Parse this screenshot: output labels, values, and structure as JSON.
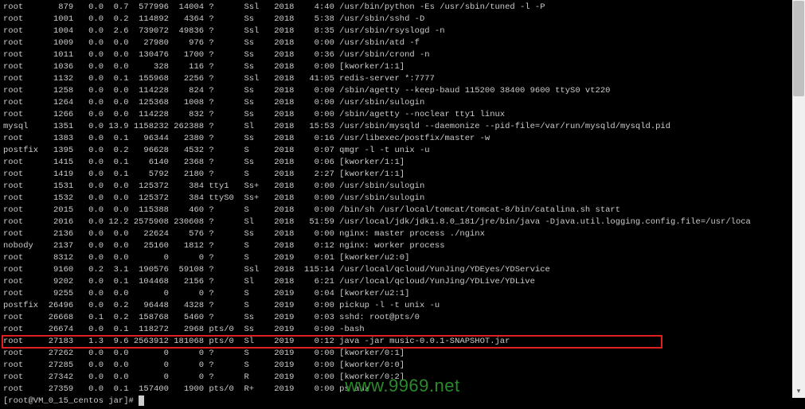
{
  "watermark": "www.9969.net",
  "prompt": "[root@VM_0_15_centos jar]# ",
  "highlight_row_index": 26,
  "rows": [
    {
      "user": "root",
      "pid": "879",
      "cpu": "0.0",
      "mem": "0.7",
      "vsz": "577996",
      "rss": "14004",
      "tty": "?",
      "stat": "Ssl",
      "start": "2018",
      "time": "4:40",
      "cmd": "/usr/bin/python -Es /usr/sbin/tuned -l -P"
    },
    {
      "user": "root",
      "pid": "1001",
      "cpu": "0.0",
      "mem": "0.2",
      "vsz": "114892",
      "rss": "4364",
      "tty": "?",
      "stat": "Ss",
      "start": "2018",
      "time": "5:38",
      "cmd": "/usr/sbin/sshd -D"
    },
    {
      "user": "root",
      "pid": "1004",
      "cpu": "0.0",
      "mem": "2.6",
      "vsz": "739072",
      "rss": "49836",
      "tty": "?",
      "stat": "Ssl",
      "start": "2018",
      "time": "8:35",
      "cmd": "/usr/sbin/rsyslogd -n"
    },
    {
      "user": "root",
      "pid": "1009",
      "cpu": "0.0",
      "mem": "0.0",
      "vsz": "27980",
      "rss": "976",
      "tty": "?",
      "stat": "Ss",
      "start": "2018",
      "time": "0:00",
      "cmd": "/usr/sbin/atd -f"
    },
    {
      "user": "root",
      "pid": "1011",
      "cpu": "0.0",
      "mem": "0.0",
      "vsz": "130476",
      "rss": "1700",
      "tty": "?",
      "stat": "Ss",
      "start": "2018",
      "time": "0:36",
      "cmd": "/usr/sbin/crond -n"
    },
    {
      "user": "root",
      "pid": "1036",
      "cpu": "0.0",
      "mem": "0.0",
      "vsz": "328",
      "rss": "116",
      "tty": "?",
      "stat": "Ss",
      "start": "2018",
      "time": "0:00",
      "cmd": "[kworker/1:1]"
    },
    {
      "user": "root",
      "pid": "1132",
      "cpu": "0.0",
      "mem": "0.1",
      "vsz": "155968",
      "rss": "2256",
      "tty": "?",
      "stat": "Ssl",
      "start": "2018",
      "time": "41:05",
      "cmd": "redis-server *:7777"
    },
    {
      "user": "root",
      "pid": "1258",
      "cpu": "0.0",
      "mem": "0.0",
      "vsz": "114228",
      "rss": "824",
      "tty": "?",
      "stat": "Ss",
      "start": "2018",
      "time": "0:00",
      "cmd": "/sbin/agetty --keep-baud 115200 38400 9600 ttyS0 vt220"
    },
    {
      "user": "root",
      "pid": "1264",
      "cpu": "0.0",
      "mem": "0.0",
      "vsz": "125368",
      "rss": "1008",
      "tty": "?",
      "stat": "Ss",
      "start": "2018",
      "time": "0:00",
      "cmd": "/usr/sbin/sulogin"
    },
    {
      "user": "root",
      "pid": "1266",
      "cpu": "0.0",
      "mem": "0.0",
      "vsz": "114228",
      "rss": "832",
      "tty": "?",
      "stat": "Ss",
      "start": "2018",
      "time": "0:00",
      "cmd": "/sbin/agetty --noclear tty1 linux"
    },
    {
      "user": "mysql",
      "pid": "1351",
      "cpu": "0.0",
      "mem": "13.9",
      "vsz": "1158232",
      "rss": "262388",
      "tty": "?",
      "stat": "Sl",
      "start": "2018",
      "time": "15:53",
      "cmd": "/usr/sbin/mysqld --daemonize --pid-file=/var/run/mysqld/mysqld.pid"
    },
    {
      "user": "root",
      "pid": "1383",
      "cpu": "0.0",
      "mem": "0.1",
      "vsz": "96344",
      "rss": "2380",
      "tty": "?",
      "stat": "Ss",
      "start": "2018",
      "time": "0:16",
      "cmd": "/usr/libexec/postfix/master -w"
    },
    {
      "user": "postfix",
      "pid": "1395",
      "cpu": "0.0",
      "mem": "0.2",
      "vsz": "96628",
      "rss": "4532",
      "tty": "?",
      "stat": "S",
      "start": "2018",
      "time": "0:07",
      "cmd": "qmgr -l -t unix -u"
    },
    {
      "user": "root",
      "pid": "1415",
      "cpu": "0.0",
      "mem": "0.1",
      "vsz": "6140",
      "rss": "2368",
      "tty": "?",
      "stat": "Ss",
      "start": "2018",
      "time": "0:06",
      "cmd": "[kworker/1:1]"
    },
    {
      "user": "root",
      "pid": "1419",
      "cpu": "0.0",
      "mem": "0.1",
      "vsz": "5792",
      "rss": "2180",
      "tty": "?",
      "stat": "S",
      "start": "2018",
      "time": "2:27",
      "cmd": "[kworker/1:1]"
    },
    {
      "user": "root",
      "pid": "1531",
      "cpu": "0.0",
      "mem": "0.0",
      "vsz": "125372",
      "rss": "384",
      "tty": "tty1",
      "stat": "Ss+",
      "start": "2018",
      "time": "0:00",
      "cmd": "/usr/sbin/sulogin"
    },
    {
      "user": "root",
      "pid": "1532",
      "cpu": "0.0",
      "mem": "0.0",
      "vsz": "125372",
      "rss": "384",
      "tty": "ttyS0",
      "stat": "Ss+",
      "start": "2018",
      "time": "0:00",
      "cmd": "/usr/sbin/sulogin"
    },
    {
      "user": "root",
      "pid": "2015",
      "cpu": "0.0",
      "mem": "0.0",
      "vsz": "115388",
      "rss": "460",
      "tty": "?",
      "stat": "S",
      "start": "2018",
      "time": "0:00",
      "cmd": "/bin/sh /usr/local/tomcat/tomcat-8/bin/catalina.sh start"
    },
    {
      "user": "root",
      "pid": "2016",
      "cpu": "0.0",
      "mem": "12.2",
      "vsz": "2575908",
      "rss": "230608",
      "tty": "?",
      "stat": "Sl",
      "start": "2018",
      "time": "51:59",
      "cmd": "/usr/local/jdk/jdk1.8.0_181/jre/bin/java -Djava.util.logging.config.file=/usr/loca"
    },
    {
      "user": "root",
      "pid": "2136",
      "cpu": "0.0",
      "mem": "0.0",
      "vsz": "22624",
      "rss": "576",
      "tty": "?",
      "stat": "Ss",
      "start": "2018",
      "time": "0:00",
      "cmd": "nginx: master process ./nginx"
    },
    {
      "user": "nobody",
      "pid": "2137",
      "cpu": "0.0",
      "mem": "0.0",
      "vsz": "25160",
      "rss": "1812",
      "tty": "?",
      "stat": "S",
      "start": "2018",
      "time": "0:12",
      "cmd": "nginx: worker process"
    },
    {
      "user": "root",
      "pid": "8312",
      "cpu": "0.0",
      "mem": "0.0",
      "vsz": "0",
      "rss": "0",
      "tty": "?",
      "stat": "S",
      "start": "2019",
      "time": "0:01",
      "cmd": "[kworker/u2:0]"
    },
    {
      "user": "root",
      "pid": "9160",
      "cpu": "0.2",
      "mem": "3.1",
      "vsz": "190576",
      "rss": "59108",
      "tty": "?",
      "stat": "Ssl",
      "start": "2018",
      "time": "115:14",
      "cmd": "/usr/local/qcloud/YunJing/YDEyes/YDService"
    },
    {
      "user": "root",
      "pid": "9202",
      "cpu": "0.0",
      "mem": "0.1",
      "vsz": "104468",
      "rss": "2156",
      "tty": "?",
      "stat": "Sl",
      "start": "2018",
      "time": "6:21",
      "cmd": "/usr/local/qcloud/YunJing/YDLive/YDLive"
    },
    {
      "user": "root",
      "pid": "9255",
      "cpu": "0.0",
      "mem": "0.0",
      "vsz": "0",
      "rss": "0",
      "tty": "?",
      "stat": "S",
      "start": "2019",
      "time": "0:04",
      "cmd": "[kworker/u2:1]"
    },
    {
      "user": "postfix",
      "pid": "26496",
      "cpu": "0.0",
      "mem": "0.2",
      "vsz": "96448",
      "rss": "4328",
      "tty": "?",
      "stat": "S",
      "start": "2019",
      "time": "0:00",
      "cmd": "pickup -l -t unix -u"
    },
    {
      "user": "root",
      "pid": "26668",
      "cpu": "0.1",
      "mem": "0.2",
      "vsz": "158768",
      "rss": "5460",
      "tty": "?",
      "stat": "Ss",
      "start": "2019",
      "time": "0:03",
      "cmd": "sshd: root@pts/0"
    },
    {
      "user": "root",
      "pid": "26674",
      "cpu": "0.0",
      "mem": "0.1",
      "vsz": "118272",
      "rss": "2968",
      "tty": "pts/0",
      "stat": "Ss",
      "start": "2019",
      "time": "0:00",
      "cmd": "-bash"
    },
    {
      "user": "root",
      "pid": "27183",
      "cpu": "1.3",
      "mem": "9.6",
      "vsz": "2563912",
      "rss": "181068",
      "tty": "pts/0",
      "stat": "Sl",
      "start": "2019",
      "time": "0:12",
      "cmd": "java -jar music-0.0.1-SNAPSHOT.jar"
    },
    {
      "user": "root",
      "pid": "27262",
      "cpu": "0.0",
      "mem": "0.0",
      "vsz": "0",
      "rss": "0",
      "tty": "?",
      "stat": "S",
      "start": "2019",
      "time": "0:00",
      "cmd": "[kworker/0:1]"
    },
    {
      "user": "root",
      "pid": "27285",
      "cpu": "0.0",
      "mem": "0.0",
      "vsz": "0",
      "rss": "0",
      "tty": "?",
      "stat": "S",
      "start": "2019",
      "time": "0:00",
      "cmd": "[kworker/0:0]"
    },
    {
      "user": "root",
      "pid": "27342",
      "cpu": "0.0",
      "mem": "0.0",
      "vsz": "0",
      "rss": "0",
      "tty": "?",
      "stat": "R",
      "start": "2019",
      "time": "0:00",
      "cmd": "[kworker/0:2]"
    },
    {
      "user": "root",
      "pid": "27359",
      "cpu": "0.0",
      "mem": "0.1",
      "vsz": "157400",
      "rss": "1900",
      "tty": "pts/0",
      "stat": "R+",
      "start": "2019",
      "time": "0:00",
      "cmd": "ps aux"
    }
  ]
}
